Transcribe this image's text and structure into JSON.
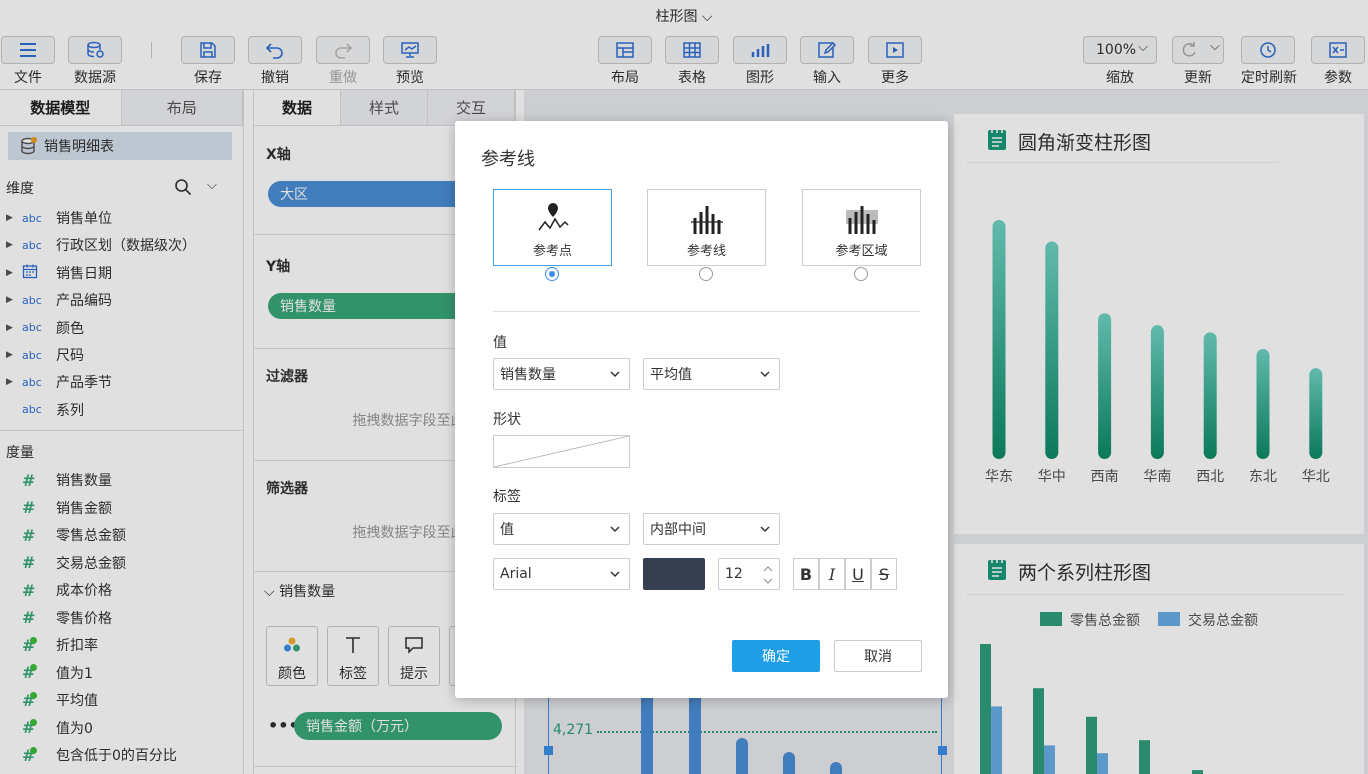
{
  "app": {
    "title": "柱形图"
  },
  "toolbar": {
    "file": "文件",
    "datasource": "数据源",
    "save": "保存",
    "undo": "撤销",
    "redo": "重做",
    "preview": "预览",
    "layout": "布局",
    "table": "表格",
    "chart": "图形",
    "input": "输入",
    "more": "更多",
    "zoom_value": "100%",
    "zoom": "缩放",
    "refresh": "更新",
    "timed_refresh": "定时刷新",
    "params": "参数"
  },
  "left": {
    "tabs": [
      "数据模型",
      "布局"
    ],
    "dataset": "销售明细表",
    "dimension_title": "维度",
    "dimensions": [
      {
        "type": "abc",
        "label": "销售单位"
      },
      {
        "type": "abc",
        "label": "行政区划（数据级次）"
      },
      {
        "type": "date",
        "label": "销售日期"
      },
      {
        "type": "abc",
        "label": "产品编码"
      },
      {
        "type": "abc",
        "label": "颜色"
      },
      {
        "type": "abc",
        "label": "尺码"
      },
      {
        "type": "abc",
        "label": "产品季节"
      },
      {
        "type": "abc",
        "label": "系列"
      }
    ],
    "measure_title": "度量",
    "measures": [
      "销售数量",
      "销售金额",
      "零售总金额",
      "交易总金额",
      "成本价格",
      "零售价格",
      "折扣率",
      "值为1",
      "平均值",
      "值为0",
      "包含低于0的百分比"
    ]
  },
  "middle": {
    "tabs": [
      "数据",
      "样式",
      "交互"
    ],
    "x_axis_label": "X轴",
    "x_axis_field": "大区",
    "y_axis_label": "Y轴",
    "y_axis_field": "销售数量",
    "filter_label": "过滤器",
    "filter_hint": "拖拽数据字段至此处",
    "screener_label": "筛选器",
    "screener_hint": "拖拽数据字段至此处",
    "measure_section": "销售数量",
    "marks": [
      "颜色",
      "标签",
      "提示"
    ],
    "bottom_field": "销售金额（万元）"
  },
  "canvas": {
    "card1_title": "圆角渐变柱形图",
    "card2_title": "两个系列柱形图",
    "ref_value": "4,271"
  },
  "chart_data": [
    {
      "type": "bar",
      "title": "圆角渐变柱形图",
      "categories": [
        "华东",
        "华中",
        "西南",
        "华南",
        "西北",
        "东北",
        "华北"
      ],
      "values": [
        100,
        91,
        61,
        56,
        53,
        46,
        38
      ],
      "ylim": [
        0,
        100
      ]
    },
    {
      "type": "bar",
      "title": "两个系列柱形图",
      "legend": "top",
      "series": [
        {
          "name": "零售总金额",
          "values": [
            100,
            66,
            44,
            26,
            3,
            0
          ]
        },
        {
          "name": "交易总金额",
          "values": [
            52,
            22,
            16,
            0,
            0,
            0
          ]
        }
      ]
    }
  ],
  "dialog": {
    "title": "参考线",
    "options": [
      "参考点",
      "参考线",
      "参考区域"
    ],
    "value_label": "值",
    "value_field": "销售数量",
    "value_agg": "平均值",
    "shape_label": "形状",
    "tag_label": "标签",
    "tag_content": "值",
    "tag_position": "内部中间",
    "font": "Arial",
    "font_color": "#353f4f",
    "font_size": "12",
    "ok": "确定",
    "cancel": "取消"
  },
  "colors": {
    "accent": "#1f9ee8",
    "pill_blue": "#4a8fd6",
    "pill_green": "#3aa87a",
    "bar_teal": "#1a9a7a",
    "bar_blue": "#6aaee6"
  }
}
